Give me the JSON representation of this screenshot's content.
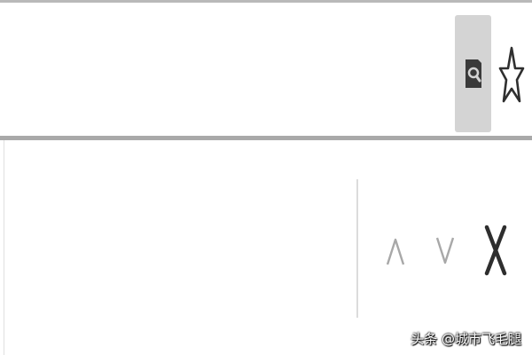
{
  "toolbar": {
    "zoom_icon": "zoom-magnifier-icon",
    "bookmark_icon": "star-outline-icon"
  },
  "find_bar": {
    "query": "",
    "prev_icon": "chevron-up-icon",
    "next_icon": "chevron-down-icon",
    "close_icon": "close-icon"
  },
  "watermark": {
    "text": "头条 @城市飞毛腿"
  },
  "colors": {
    "zoom_button_bg": "#d4d4d4",
    "icon_dark": "#3a3a3a",
    "icon_light": "#a8a8a8"
  }
}
